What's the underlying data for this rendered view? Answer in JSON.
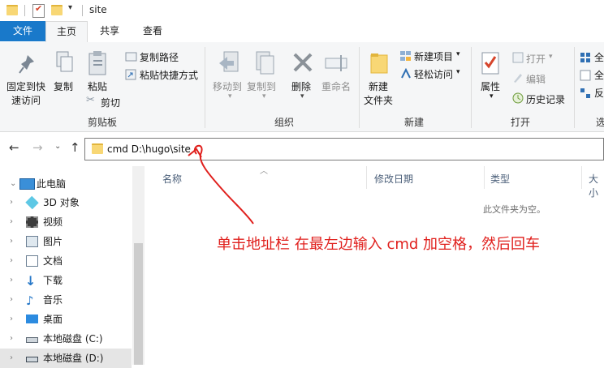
{
  "window": {
    "title": "site"
  },
  "ribbon_tabs": [
    "文件",
    "主页",
    "共享",
    "查看"
  ],
  "clipboard": {
    "pin_label_1": "固定到快",
    "pin_label_2": "速访问",
    "copy": "复制",
    "paste": "粘贴",
    "copy_path": "复制路径",
    "paste_shortcut": "粘贴快捷方式",
    "cut": "剪切",
    "group": "剪贴板"
  },
  "organize": {
    "move_to": "移动到",
    "copy_to": "复制到",
    "delete": "删除",
    "rename": "重命名",
    "group": "组织"
  },
  "new": {
    "new_folder_1": "新建",
    "new_folder_2": "文件夹",
    "new_item": "新建项目",
    "easy_access": "轻松访问",
    "group": "新建"
  },
  "open": {
    "properties": "属性",
    "open": "打开",
    "edit": "编辑",
    "history": "历史记录",
    "group": "打开"
  },
  "select": {
    "item1": "全",
    "item2": "全",
    "item3": "反",
    "group": "选"
  },
  "address": {
    "value": "cmd D:\\hugo\\site"
  },
  "nav": {
    "items": [
      {
        "label": "此电脑",
        "icon": "pc-icon",
        "expanded": true
      },
      {
        "label": "3D 对象",
        "icon": "3d-objects-icon"
      },
      {
        "label": "视频",
        "icon": "video-icon"
      },
      {
        "label": "图片",
        "icon": "pictures-icon"
      },
      {
        "label": "文档",
        "icon": "documents-icon"
      },
      {
        "label": "下载",
        "icon": "downloads-icon"
      },
      {
        "label": "音乐",
        "icon": "music-icon"
      },
      {
        "label": "桌面",
        "icon": "desktop-icon"
      },
      {
        "label": "本地磁盘 (C:)",
        "icon": "drive-icon"
      },
      {
        "label": "本地磁盘 (D:)",
        "icon": "drive-icon",
        "selected": true
      }
    ]
  },
  "columns": {
    "name": "名称",
    "date": "修改日期",
    "type": "类型",
    "size": "大小"
  },
  "empty_message": "此文件夹为空。",
  "annotation": "单击地址栏 在最左边输入 cmd 加空格，然后回车",
  "colors": {
    "accent": "#1979ca",
    "annotation": "#e0201d",
    "folder": "#f8d775"
  }
}
